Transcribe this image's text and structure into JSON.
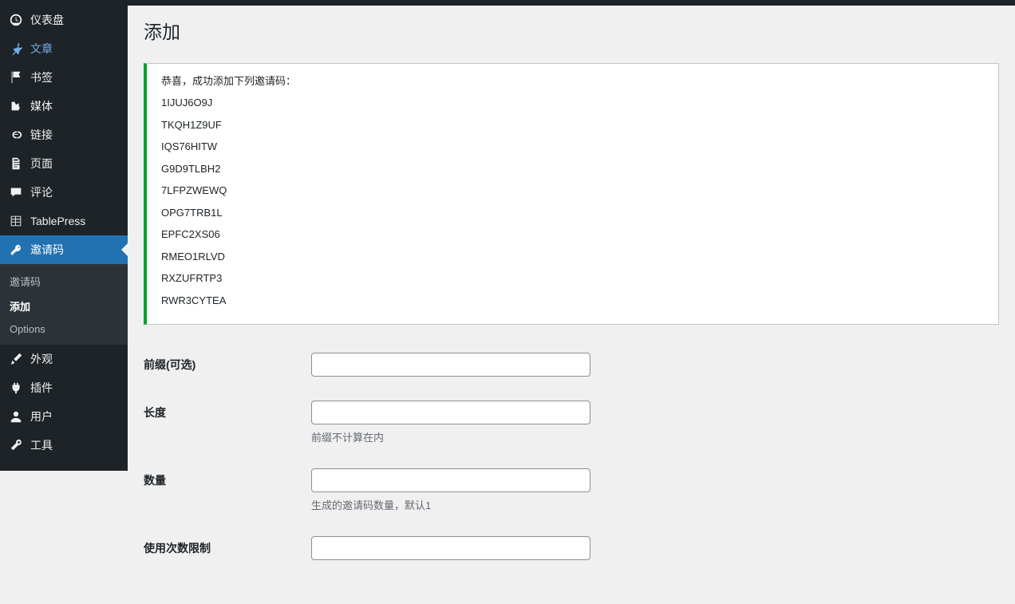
{
  "sidebar": {
    "items": [
      {
        "id": "dashboard",
        "label": "仪表盘",
        "icon": "dashboard"
      },
      {
        "id": "posts",
        "label": "文章",
        "icon": "pin"
      },
      {
        "id": "bookmarks",
        "label": "书签",
        "icon": "flag"
      },
      {
        "id": "media",
        "label": "媒体",
        "icon": "media"
      },
      {
        "id": "links",
        "label": "链接",
        "icon": "link"
      },
      {
        "id": "pages",
        "label": "页面",
        "icon": "page"
      },
      {
        "id": "comments",
        "label": "评论",
        "icon": "comment"
      },
      {
        "id": "tablepress",
        "label": "TablePress",
        "icon": "table"
      },
      {
        "id": "invitation",
        "label": "邀请码",
        "icon": "key"
      },
      {
        "id": "appearance",
        "label": "外观",
        "icon": "brush"
      },
      {
        "id": "plugins",
        "label": "插件",
        "icon": "plugin"
      },
      {
        "id": "users",
        "label": "用户",
        "icon": "user"
      },
      {
        "id": "tools",
        "label": "工具",
        "icon": "wrench"
      }
    ],
    "submenu": [
      {
        "label": "邀请码"
      },
      {
        "label": "添加"
      },
      {
        "label": "Options"
      }
    ]
  },
  "page": {
    "title": "添加"
  },
  "notice": {
    "message": "恭喜，成功添加下列邀请码：",
    "codes": [
      "1IJUJ6O9J",
      "TKQH1Z9UF",
      "IQS76HITW",
      "G9D9TLBH2",
      "7LFPZWEWQ",
      "OPG7TRB1L",
      "EPFC2XS06",
      "RMEO1RLVD",
      "RXZUFRTP3",
      "RWR3CYTEA"
    ]
  },
  "form": {
    "fields": [
      {
        "key": "prefix",
        "label": "前缀(可选)",
        "value": "",
        "help": ""
      },
      {
        "key": "length",
        "label": "长度",
        "value": "",
        "help": "前缀不计算在内"
      },
      {
        "key": "count",
        "label": "数量",
        "value": "",
        "help": "生成的邀请码数量，默认1"
      },
      {
        "key": "usage_limit",
        "label": "使用次数限制",
        "value": "",
        "help": ""
      }
    ]
  }
}
